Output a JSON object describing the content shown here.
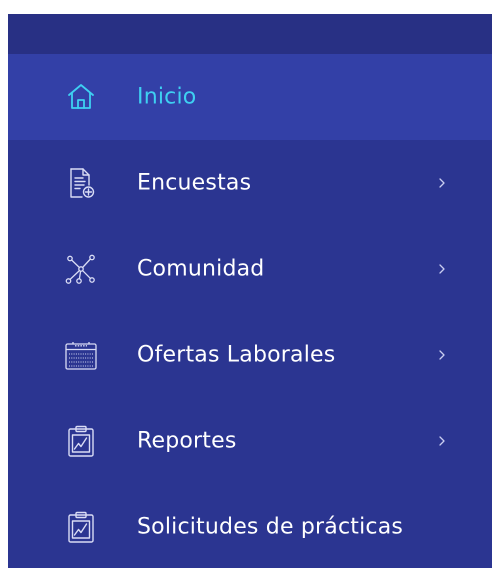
{
  "colors": {
    "sidebar_bg": "#2b3591",
    "header_bg": "#283084",
    "active_bg": "#3340a7",
    "active_text": "#3ed0f2",
    "text": "#ffffff"
  },
  "menu": {
    "items": [
      {
        "label": "Inicio",
        "icon": "home-icon",
        "active": true,
        "has_submenu": false
      },
      {
        "label": "Encuestas",
        "icon": "survey-document-icon",
        "active": false,
        "has_submenu": true
      },
      {
        "label": "Comunidad",
        "icon": "network-icon",
        "active": false,
        "has_submenu": true
      },
      {
        "label": "Ofertas Laborales",
        "icon": "calendar-icon",
        "active": false,
        "has_submenu": true
      },
      {
        "label": "Reportes",
        "icon": "clipboard-chart-icon",
        "active": false,
        "has_submenu": true
      },
      {
        "label": "Solicitudes de prácticas",
        "icon": "clipboard-chart-icon",
        "active": false,
        "has_submenu": false
      }
    ]
  }
}
